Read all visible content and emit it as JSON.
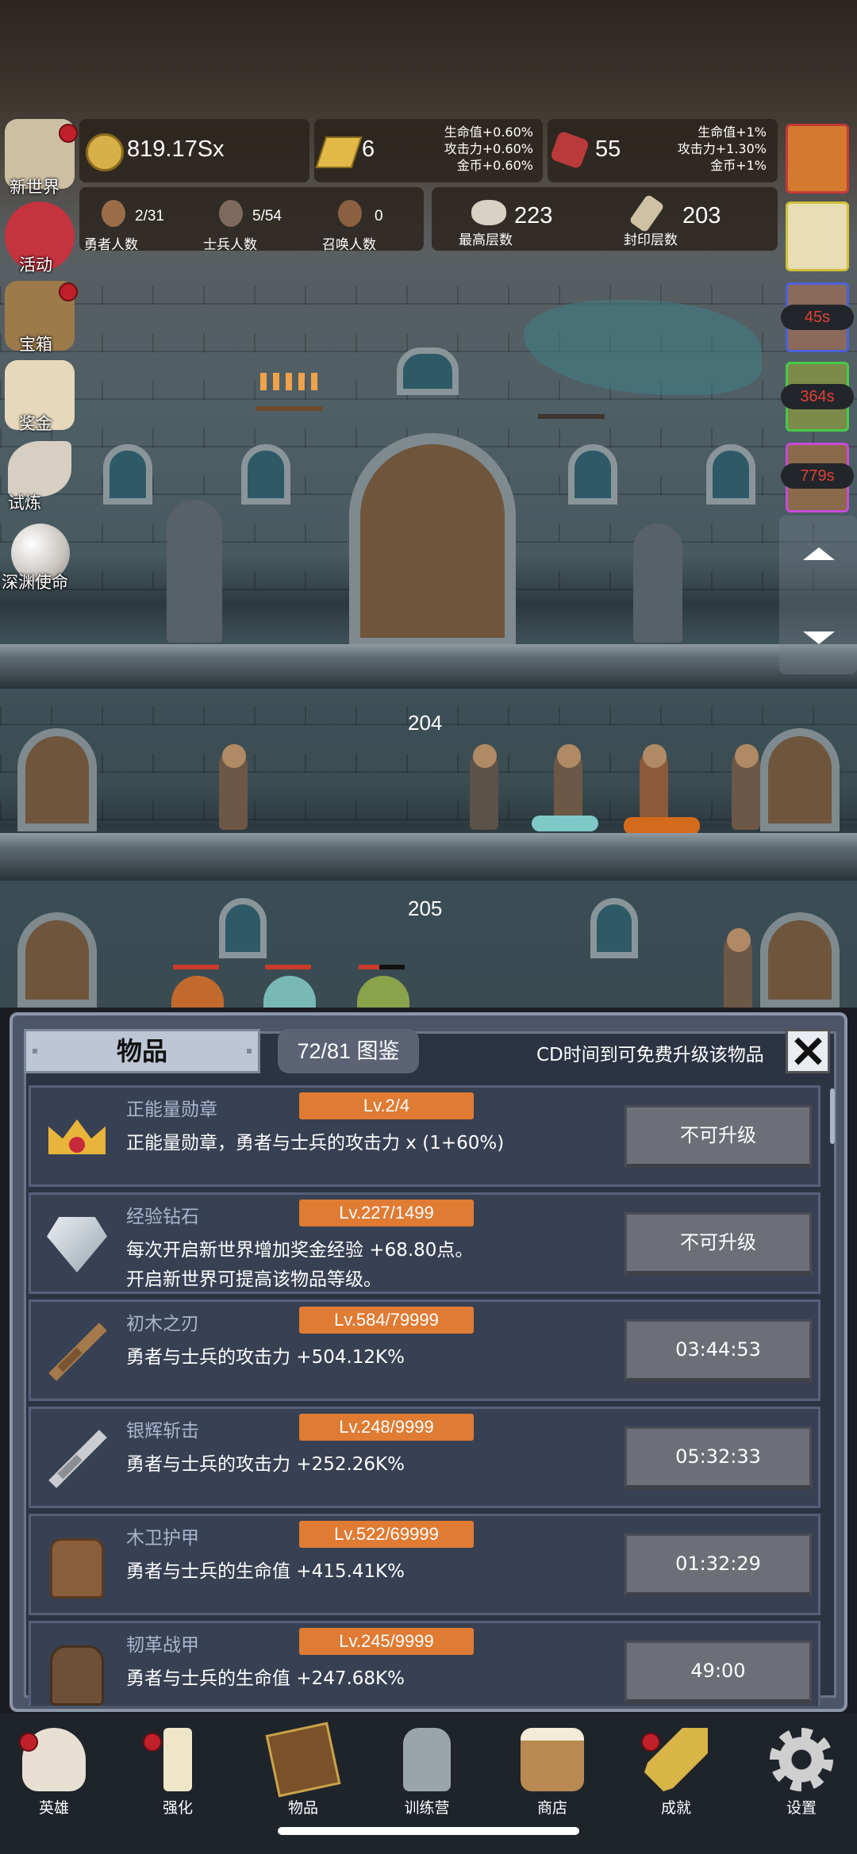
{
  "hud": {
    "gold": "819.17Sx",
    "gold_bar": "6",
    "gold_bar_bonus": [
      "生命值+0.60%",
      "攻击力+0.60%",
      "金币+0.60%"
    ],
    "ruby": "55",
    "ruby_bonus": [
      "生命值+1%",
      "攻击力+1.30%",
      "金币+1%"
    ],
    "heroes_count": "2/31",
    "heroes_label": "勇者人数",
    "soldiers_count": "5/54",
    "soldiers_label": "士兵人数",
    "summons_count": "0",
    "summons_label": "召唤人数",
    "max_floor": "223",
    "max_floor_label": "最高层数",
    "sealed_floor": "203",
    "sealed_floor_label": "封印层数"
  },
  "side_menu": [
    {
      "label": "新世界",
      "icon": "map-scroll-icon",
      "dot": true
    },
    {
      "label": "活动",
      "icon": "heart-icon",
      "dot": false
    },
    {
      "label": "宝箱",
      "icon": "treasure-chest-icon",
      "dot": true
    },
    {
      "label": "奖金",
      "icon": "envelope-icon",
      "dot": false
    },
    {
      "label": "试炼",
      "icon": "quill-icon",
      "dot": false
    },
    {
      "label": "深渊使命",
      "icon": "pearl-icon",
      "dot": false
    }
  ],
  "buffs": {
    "timers": [
      "45s",
      "364s",
      "779s"
    ]
  },
  "scene": {
    "floor_a": "204",
    "floor_b": "205"
  },
  "panel": {
    "tab_label": "物品",
    "dex_label": "72/81 图鉴",
    "cd_notice": "CD时间到可免费升级该物品",
    "items": [
      {
        "name": "正能量勋章",
        "level": "Lv.2/4",
        "desc": "正能量勋章，勇者与士兵的攻击力 x (1+60%)",
        "button": "不可升级",
        "icon": "crown-medal-icon"
      },
      {
        "name": "经验钻石",
        "level": "Lv.227/1499",
        "desc": "每次开启新世界增加奖金经验 +68.80点。\n开启新世界可提高该物品等级。",
        "button": "不可升级",
        "icon": "diamond-icon"
      },
      {
        "name": "初木之刃",
        "level": "Lv.584/79999",
        "desc": "勇者与士兵的攻击力 +504.12K%",
        "button": "03:44:53",
        "icon": "wooden-sword-icon"
      },
      {
        "name": "银辉斩击",
        "level": "Lv.248/9999",
        "desc": "勇者与士兵的攻击力 +252.26K%",
        "button": "05:32:33",
        "icon": "silver-sword-icon"
      },
      {
        "name": "木卫护甲",
        "level": "Lv.522/69999",
        "desc": "勇者与士兵的生命值 +415.41K%",
        "button": "01:32:29",
        "icon": "wooden-armor-icon"
      },
      {
        "name": "韧革战甲",
        "level": "Lv.245/9999",
        "desc": "勇者与士兵的生命值 +247.68K%",
        "button": "49:00",
        "icon": "leather-armor-icon"
      }
    ]
  },
  "bottom_nav": [
    {
      "label": "英雄",
      "icon": "skull-icon",
      "dot": true
    },
    {
      "label": "强化",
      "icon": "candle-icon",
      "dot": true
    },
    {
      "label": "物品",
      "icon": "book-icon",
      "dot": false
    },
    {
      "label": "训练营",
      "icon": "lantern-icon",
      "dot": false
    },
    {
      "label": "商店",
      "icon": "beer-mug-icon",
      "dot": false
    },
    {
      "label": "成就",
      "icon": "key-icon",
      "dot": true
    },
    {
      "label": "设置",
      "icon": "gear-icon",
      "dot": false
    }
  ],
  "colors": {
    "level_badge": "#e07b33",
    "panel_bg": "#2c3443",
    "timer_red": "#e0403a",
    "notification_dot": "#c0202a"
  }
}
